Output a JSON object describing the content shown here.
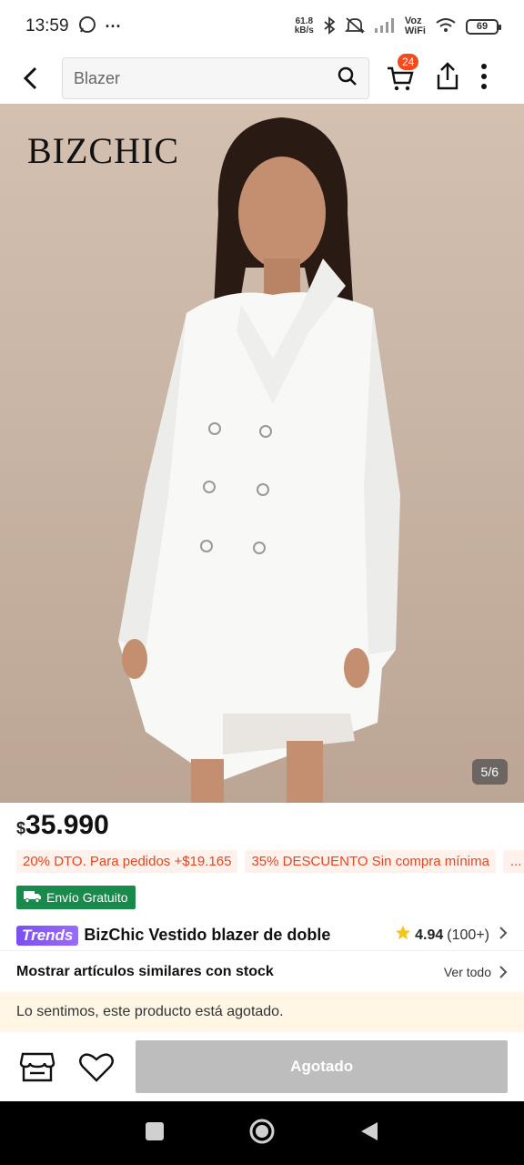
{
  "status_bar": {
    "time": "13:59",
    "net_speed_value": "61.8",
    "net_speed_unit": "kB/s",
    "voz": "Voz",
    "wifi": "WiFi",
    "battery": "69"
  },
  "top_nav": {
    "search_text": "Blazer",
    "cart_count": "24"
  },
  "product": {
    "brand": "BIZCHIC",
    "image_counter": "5/6",
    "currency": "$",
    "price": "35.990",
    "promos": [
      "20% DTO. Para pedidos +$19.165",
      "35% DESCUENTO Sin compra mínima"
    ],
    "promo_more": "...",
    "shipping": "Envío Gratuito",
    "trends_badge": "Trends",
    "title": "BizChic Vestido blazer de doble",
    "rating": "4.94",
    "rating_count": "(100+)"
  },
  "similar": {
    "label": "Mostrar artículos similares con stock",
    "see_all": "Ver todo"
  },
  "notice": "Lo sentimos, este producto está agotado.",
  "action_bar": {
    "button_label": "Agotado"
  },
  "colors": {
    "accent_orange": "#f54a1d",
    "promo_text": "#e8451e",
    "shipping_green": "#1a8a4c",
    "trends_purple": "#7a4ff0",
    "disabled_gray": "#bdbdbd",
    "notice_bg": "#fff6e5"
  }
}
